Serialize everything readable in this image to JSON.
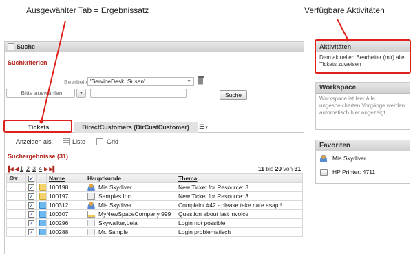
{
  "annotations": {
    "left": "Ausgewählter Tab = Ergebnissatz",
    "right": "Verfügbare Aktivitäten"
  },
  "search_panel": {
    "title": "Suche",
    "criteria_title": "Suchkriterien",
    "bearbeiter_label": "Bearbeiter",
    "bearbeiter_value": "'ServiceDesk, Susan'",
    "select_placeholder": "Bitte auswählen",
    "search_button": "Suche"
  },
  "tabs": [
    {
      "label": "Tickets",
      "selected": true
    },
    {
      "label": "DirectCustomers (DirCustCustomer)",
      "selected": false
    }
  ],
  "view": {
    "label": "Anzeigen als:",
    "list": "Liste",
    "grid": "Grid"
  },
  "results": {
    "title": "Suchergebnisse (31)",
    "pages": [
      "1",
      "2",
      "3",
      "4"
    ],
    "range_from": "11",
    "range_mid": "bis",
    "range_to": "20",
    "range_of": "von",
    "range_total": "31",
    "columns": [
      "Name",
      "Hauptkunde",
      "Thema"
    ],
    "rows": [
      {
        "icon": "folder",
        "name": "100198",
        "cust_icon": "person",
        "customer": "Mia Skydiver",
        "topic": "New Ticket for Resource: 3"
      },
      {
        "icon": "folder",
        "name": "100197",
        "cust_icon": "company",
        "customer": "Samples Inc.",
        "topic": "New Ticket for Resource: 3"
      },
      {
        "icon": "blue",
        "name": "100312",
        "cust_icon": "person",
        "customer": "Mia Skydiver",
        "topic": "Complaint #42 - please take care asap!!"
      },
      {
        "icon": "blue",
        "name": "100307",
        "cust_icon": "building",
        "customer": "MyNewSpaceCompany 999",
        "topic": "Question about last invoice"
      },
      {
        "icon": "blue",
        "name": "100296",
        "cust_icon": "blank",
        "customer": "Skywalker,Leia",
        "topic": "Login not possible"
      },
      {
        "icon": "blue",
        "name": "100288",
        "cust_icon": "blank",
        "customer": "Mr. Sample",
        "topic": "Login problematisch"
      }
    ]
  },
  "activities": {
    "title": "Aktivitäten",
    "text": "Dem aktuellen Bearbeiter (mir) alle Tickets zuweisen"
  },
  "workspace": {
    "title": "Workspace",
    "text": "Workspace ist leer Alle ungespeicherten Vorgänge werden automatisch hier angezeigt."
  },
  "favorites": {
    "title": "Favoriten",
    "items": [
      {
        "icon": "person",
        "label": "Mia Skydiver"
      },
      {
        "icon": "printer",
        "label": "HP Printer: 4711"
      }
    ]
  },
  "colors": {
    "accent_red": "#b3261e",
    "callout_red": "#e0201b"
  }
}
